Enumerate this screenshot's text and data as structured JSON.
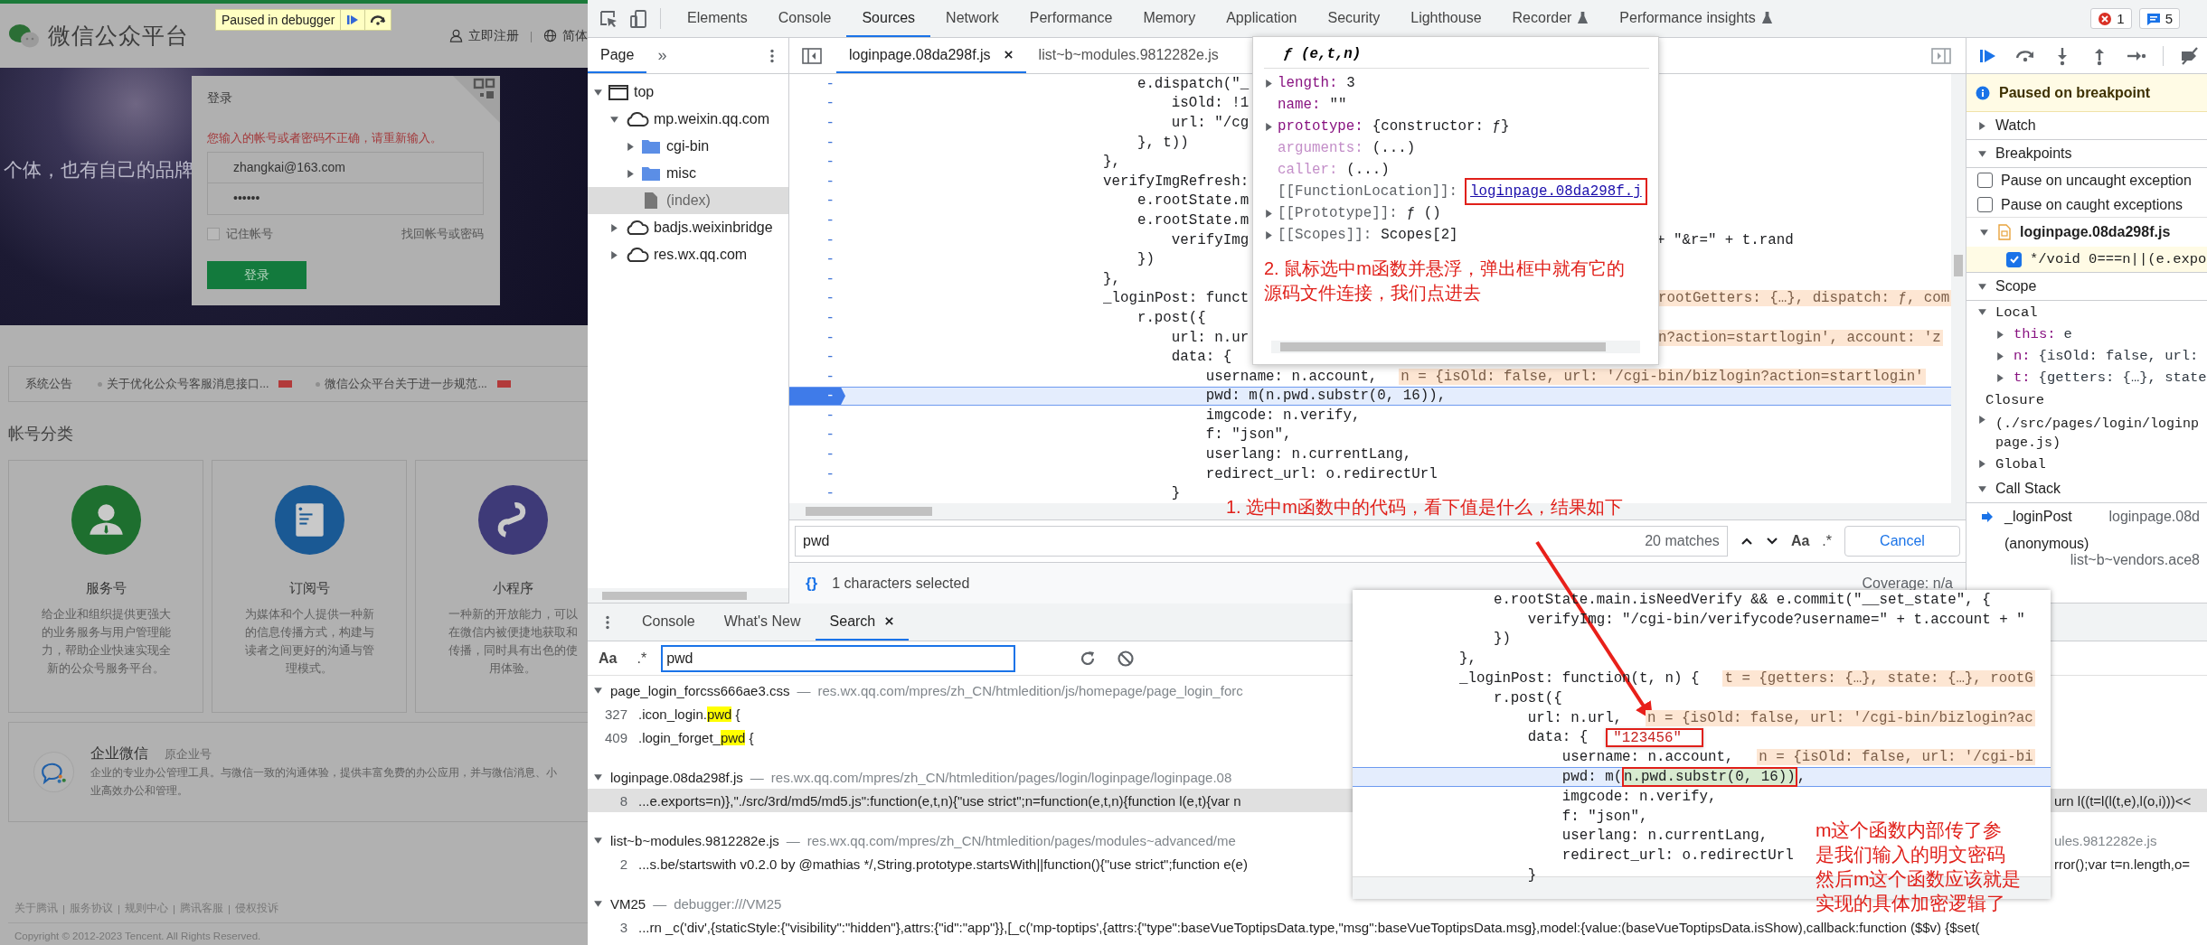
{
  "browser_page": {
    "debugger_badge": "Paused in debugger",
    "site_title": "微信公众平台",
    "header": {
      "register": "立即注册",
      "separator": "|",
      "language": "简体"
    },
    "banner_text": "个体，也有自己的品牌",
    "login": {
      "title": "登录",
      "error": "您输入的帐号或者密码不正确，请重新输入。",
      "account": "zhangkai@163.com",
      "password": "••••••",
      "remember": {
        "label": "记住帐号",
        "checked": false
      },
      "forgot": "找回帐号或密码",
      "submit": "登录"
    },
    "notices": {
      "title": "系统公告",
      "items": [
        {
          "text": "关于优化公众号客服消息接口...",
          "new": true
        },
        {
          "text": "微信公众平台关于进一步规范...",
          "new": true
        }
      ]
    },
    "section_title": "帐号分类",
    "account_types": [
      {
        "kind": "service",
        "color": "#1e6f2f",
        "title": "服务号",
        "description": "给企业和组织提供更强大的业务服务与用户管理能力，帮助企业快速实现全新的公众号服务平台。"
      },
      {
        "kind": "subscription",
        "color": "#1a5994",
        "title": "订阅号",
        "description": "为媒体和个人提供一种新的信息传播方式，构建与读者之间更好的沟通与管理模式。"
      },
      {
        "kind": "miniprogram",
        "color": "#3e3a78",
        "title": "小程序",
        "description": "一种新的开放能力，可以在微信内被便捷地获取和传播，同时具有出色的使用体验。"
      }
    ],
    "enterprise": {
      "title": "企业微信",
      "subtitle": "原企业号",
      "lines": [
        "企业的专业办公管理工具。与微信一致的沟通体验，提供丰富免费的办公应用，并与微信消息、小",
        "业高效办公和管理。"
      ]
    },
    "footer": {
      "links": [
        "关于腾讯",
        "服务协议",
        "规则中心",
        "腾讯客服",
        "侵权投诉"
      ],
      "separator": "|"
    },
    "copyright": "Copyright © 2012-2023 Tencent. All Rights Reserved."
  },
  "devtools": {
    "tabs": [
      {
        "label": "Elements",
        "selected": false,
        "experimental": false
      },
      {
        "label": "Console",
        "selected": false,
        "experimental": false
      },
      {
        "label": "Sources",
        "selected": true,
        "experimental": false
      },
      {
        "label": "Network",
        "selected": false,
        "experimental": false
      },
      {
        "label": "Performance",
        "selected": false,
        "experimental": false
      },
      {
        "label": "Memory",
        "selected": false,
        "experimental": false
      },
      {
        "label": "Application",
        "selected": false,
        "experimental": false
      },
      {
        "label": "Security",
        "selected": false,
        "experimental": false
      },
      {
        "label": "Lighthouse",
        "selected": false,
        "experimental": false
      },
      {
        "label": "Recorder",
        "selected": false,
        "experimental": true
      },
      {
        "label": "Performance insights",
        "selected": false,
        "experimental": true
      }
    ],
    "issues": {
      "errors": "1",
      "messages": "5"
    },
    "navigator": {
      "tabs": [
        {
          "label": "Page",
          "selected": true
        }
      ],
      "more": "»",
      "tree": [
        {
          "kind": "frame",
          "label": "top",
          "expanded": true,
          "selected": false,
          "children": [
            {
              "kind": "domain",
              "label": "mp.weixin.qq.com",
              "expanded": true,
              "selected": false,
              "children": [
                {
                  "kind": "folder",
                  "label": "cgi-bin",
                  "expanded": false,
                  "selected": false
                },
                {
                  "kind": "folder",
                  "label": "misc",
                  "expanded": false,
                  "selected": false
                },
                {
                  "kind": "file",
                  "label": "(index)",
                  "selected": true
                }
              ]
            },
            {
              "kind": "domain",
              "label": "badjs.weixinbridge",
              "expanded": false,
              "selected": false
            },
            {
              "kind": "domain",
              "label": "res.wx.qq.com",
              "expanded": false,
              "selected": false
            }
          ]
        }
      ]
    },
    "editor": {
      "tabs": [
        {
          "label": "loginpage.08da298f.js",
          "selected": true,
          "closable": true
        },
        {
          "label": "list~b~modules.9812282e.js",
          "selected": false,
          "closable": false
        }
      ],
      "lines": [
        {
          "gutter": "-",
          "code": "    e.dispatch(\"_",
          "current": false
        },
        {
          "gutter": "-",
          "code": "        isOld: !1",
          "current": false
        },
        {
          "gutter": "-",
          "code": "        url: \"/cg",
          "current": false
        },
        {
          "gutter": "-",
          "code": "    }, t))",
          "current": false
        },
        {
          "gutter": "-",
          "code": "},",
          "current": false
        },
        {
          "gutter": "-",
          "code": "verifyImgRefresh:",
          "current": false
        },
        {
          "gutter": "-",
          "code": "    e.rootState.m",
          "current": false
        },
        {
          "gutter": "-",
          "code": "    e.rootState.m",
          "current": false
        },
        {
          "gutter": "-",
          "code": "        verifyImg",
          "current": false,
          "tail": "+ \"&r=\" + t.rand"
        },
        {
          "gutter": "-",
          "code": "    })",
          "current": false
        },
        {
          "gutter": "-",
          "code": "},",
          "current": false
        },
        {
          "gutter": "-",
          "code": "_loginPost: funct",
          "current": false,
          "tail_value": "rootGetters: {…}, dispatch: ƒ, com"
        },
        {
          "gutter": "-",
          "code": "    r.post({",
          "current": false
        },
        {
          "gutter": "-",
          "code": "        url: n.ur",
          "current": false,
          "tail_value": "n?action=startlogin', account: 'z"
        },
        {
          "gutter": "-",
          "code": "        data: {",
          "current": false
        },
        {
          "gutter": "-",
          "code": "            username: n.account,",
          "current": false,
          "value": "n = {isOld: false, url: '/cgi-bin/bizlogin?action=startlogin'"
        },
        {
          "gutter": "-",
          "code": "            pwd: m(n.pwd.substr(0, 16)),",
          "current": true
        },
        {
          "gutter": "-",
          "code": "            imgcode: n.verify,",
          "current": false
        },
        {
          "gutter": "-",
          "code": "            f: \"json\",",
          "current": false
        },
        {
          "gutter": "-",
          "code": "            userlang: n.currentLang,",
          "current": false
        },
        {
          "gutter": "-",
          "code": "            redirect_url: o.redirectUrl",
          "current": false
        },
        {
          "gutter": "-",
          "code": "        }",
          "current": false
        }
      ],
      "find": {
        "query": "pwd",
        "matches": "20 matches",
        "case_label": "Aa",
        "regex_label": ".*",
        "cancel": "Cancel"
      },
      "status": {
        "format_label": "{}",
        "selection": "1 characters selected",
        "coverage": "Coverage: n/a"
      }
    },
    "debugger": {
      "paused_message": "Paused on breakpoint",
      "watch": {
        "title": "Watch",
        "expanded": false
      },
      "breakpoints": {
        "title": "Breakpoints",
        "expanded": true,
        "options": [
          {
            "label": "Pause on uncaught exception",
            "checked": false
          },
          {
            "label": "Pause on caught exceptions",
            "checked": false
          }
        ],
        "files": [
          {
            "name": "loginpage.08da298f.js",
            "expanded": true,
            "items": [
              {
                "code": "*/void 0===n||(e.expo",
                "checked": true
              }
            ]
          }
        ]
      },
      "scope": {
        "title": "Scope",
        "expanded": true,
        "groups": [
          {
            "label": "Local",
            "expanded": true,
            "entries": [
              {
                "name": "this:",
                "value": "e"
              },
              {
                "name": "n:",
                "value": "{isOld: false, url:"
              },
              {
                "name": "t:",
                "value": "{getters: {…}, state"
              }
            ]
          },
          {
            "label": "Closure",
            "entries": [
              {
                "lines": [
                  "(./src/pages/login/loginp",
                  "page.js)"
                ]
              }
            ]
          },
          {
            "label": "Global",
            "expanded": false
          }
        ]
      },
      "call_stack": {
        "title": "Call Stack",
        "expanded": true,
        "frames": [
          {
            "name": "_loginPost",
            "location": "loginpage.08d",
            "current": true
          },
          {
            "name": "(anonymous)",
            "location": "list~b~vendors.ace8",
            "current": false
          }
        ]
      }
    },
    "drawer": {
      "tabs": [
        {
          "label": "Console",
          "selected": false,
          "closable": false
        },
        {
          "label": "What's New",
          "selected": false,
          "closable": false
        },
        {
          "label": "Search",
          "selected": true,
          "closable": true
        }
      ],
      "search": {
        "case_label": "Aa",
        "regex_label": ".*",
        "query": "pwd"
      },
      "results": [
        {
          "file": "page_login_forcss666ae3.css",
          "separator": "—",
          "path": "res.wx.qq.com/mpres/zh_CN/htmledition/js/homepage/page_login_forc",
          "matches": [
            {
              "line": "327",
              "before": ".icon_login.",
              "match": "pwd",
              "after": " {",
              "selected": false
            },
            {
              "line": "409",
              "before": ".login_forget_",
              "match": "pwd",
              "after": " {",
              "selected": false
            }
          ]
        },
        {
          "file": "loginpage.08da298f.js",
          "separator": "—",
          "path": "res.wx.qq.com/mpres/zh_CN/htmledition/pages/login/loginpage/loginpage.08",
          "matches": [
            {
              "line": "8",
              "before": "...e.exports=n)},\"./src/3rd/md5/md5.js\":function(e,t,n){\"use strict\";n=function(e,t,n){function l(e,t){var n",
              "selected": true,
              "right_part": "urn l((t=l(l(t,e),l(o,i)))<<"
            }
          ]
        },
        {
          "file": "list~b~modules.9812282e.js",
          "separator": "—",
          "path": "res.wx.qq.com/mpres/zh_CN/htmledition/pages/modules~advanced/me",
          "path_right_part": "ules.9812282e.js",
          "matches": [
            {
              "line": "2",
              "before": "...s.be/startswith v0.2.0 by @mathias */,String.prototype.startsWith||function(){\"use strict\";function e(e)",
              "selected": false,
              "right_part": "rror();var t=n.length,o="
            }
          ]
        },
        {
          "file": "VM25",
          "separator": "—",
          "path": "debugger:///VM25",
          "matches": [
            {
              "line": "3",
              "before": "...rn _c('div',{staticStyle:{\"visibility\":\"hidden\"},attrs:{\"id\":\"app\"}},[_c('mp-toptips',{attrs:{\"type\":baseVueToptipsData.type,\"msg\":baseVueToptipsData.msg},model:{value:(baseVueToptipsData.isShow),callback:function ($$v) {$set(",
              "selected": false
            }
          ]
        }
      ]
    }
  },
  "function_popover": {
    "signature": "ƒ (e,t,n)",
    "properties": [
      {
        "kind": "own",
        "name": "length:",
        "value": "3",
        "expanded": false
      },
      {
        "kind": "own",
        "name": "name:",
        "value": "\"\""
      },
      {
        "kind": "own",
        "name": "prototype:",
        "value": "{constructor: ƒ}",
        "expanded": false
      },
      {
        "kind": "accessor",
        "name": "arguments:",
        "value": "(...)"
      },
      {
        "kind": "accessor",
        "name": "caller:",
        "value": "(...)"
      },
      {
        "kind": "internal",
        "name": "[[FunctionLocation]]:",
        "link": "loginpage.08da298f.j"
      },
      {
        "kind": "internal",
        "name": "[[Prototype]]:",
        "value": "ƒ ()",
        "expanded": false
      },
      {
        "kind": "internal",
        "name": "[[Scopes]]:",
        "value": "Scopes[2]",
        "expanded": false
      }
    ],
    "note": [
      "2. 鼠标选中m函数并悬浮，弹出框中就有它的",
      "源码文件连接，我们点进去"
    ]
  },
  "annotation": "1. 选中m函数中的代码，看下值是什么，结果如下",
  "inset_screenshot": {
    "lines": [
      {
        "code": "    e.rootState.main.isNeedVerify && e.commit(\"__set_state\", {",
        "current": false
      },
      {
        "code": "        verifyImg: \"/cgi-bin/verifycode?username=\" + t.account + \"",
        "current": false
      },
      {
        "code": "    })",
        "current": false
      },
      {
        "code": "},",
        "current": false
      },
      {
        "code": "_loginPost: function(t, n) {",
        "current": false,
        "value": "t = {getters: {…}, state: {…}, rootG"
      },
      {
        "code": "    r.post({",
        "current": false
      },
      {
        "code": "        url: n.url,",
        "current": false,
        "value": "n = {isOld: false, url: '/cgi-bin/bizlogin?ac"
      },
      {
        "code": "        data: {",
        "current": false,
        "tooltip": "\"123456\""
      },
      {
        "code": "            username: n.account,",
        "current": false,
        "value": "n = {isOld: false, url: '/cgi-bi"
      },
      {
        "code": "            pwd: m(",
        "boxed": "n.pwd.substr(0, 16))",
        "after": ",",
        "current": true
      },
      {
        "code": "            imgcode: n.verify,",
        "current": false
      },
      {
        "code": "            f: \"json\",",
        "current": false
      },
      {
        "code": "            userlang: n.currentLang,",
        "current": false
      },
      {
        "code": "            redirect_url: o.redirectUrl",
        "current": false
      },
      {
        "code": "        }",
        "current": false
      }
    ],
    "note": [
      "m这个函数内部传了参",
      "是我们输入的明文密码",
      "然后m这个函数应该就是",
      "实现的具体加密逻辑了"
    ]
  }
}
